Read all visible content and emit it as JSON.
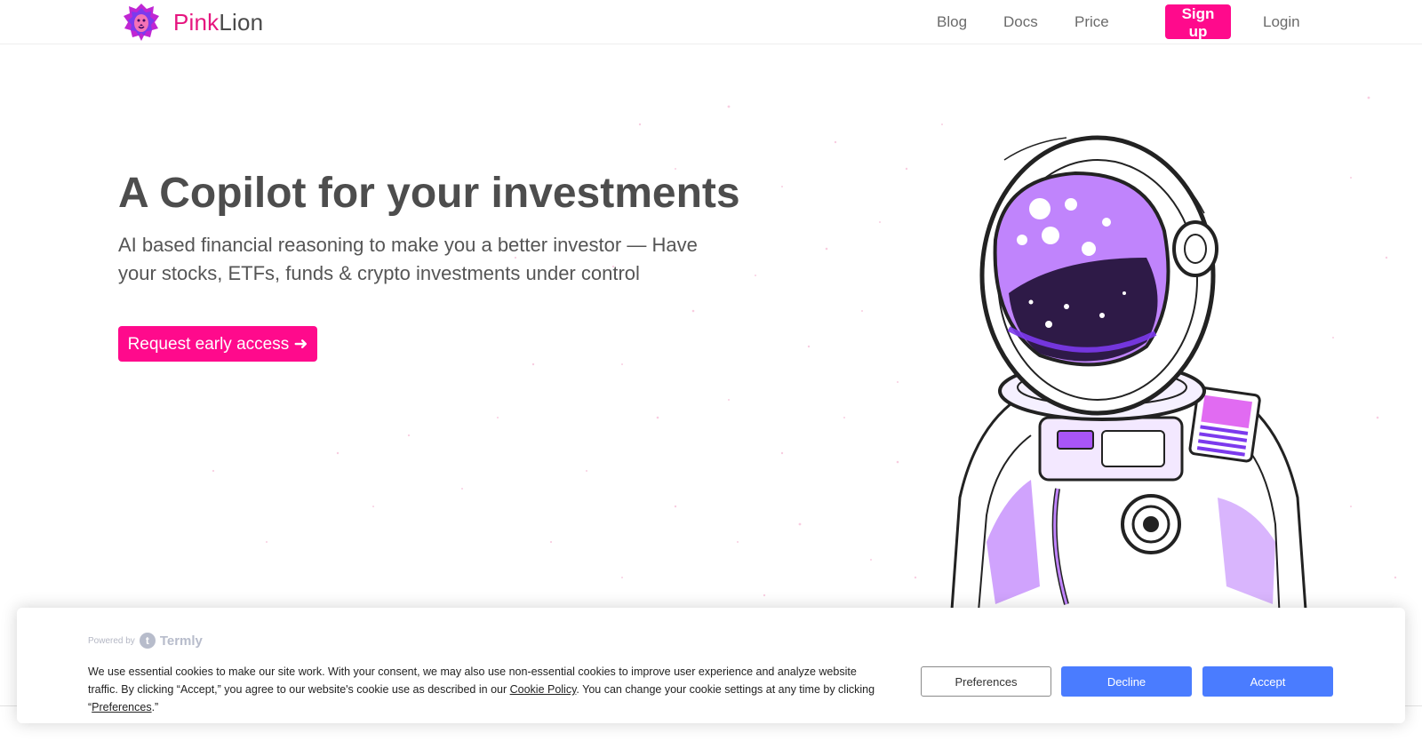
{
  "brand": {
    "name_part1": "Pink",
    "name_part2": "Lion",
    "accent_color": "#e6157f"
  },
  "nav": {
    "blog": "Blog",
    "docs": "Docs",
    "price": "Price",
    "signup": "Sign up",
    "login": "Login"
  },
  "hero": {
    "title": "A Copilot for your investments",
    "subtitle": "AI based financial reasoning to make you a better investor — Have your stocks, ETFs, funds & crypto investments under control",
    "cta": "Request early access ➜",
    "illustration": "astronaut-illustration"
  },
  "cookie": {
    "powered_by": "Powered by",
    "provider": "Termly",
    "text_part1": "We use essential cookies to make our site work. With your consent, we may also use non-essential cookies to improve user experience and analyze website traffic. By clicking “Accept,” you agree to our website's cookie use as described in our ",
    "cookie_policy_link": "Cookie Policy",
    "text_part2": ". You can change your cookie settings at any time by clicking “",
    "preferences_link": "Preferences",
    "text_part3": ".”",
    "preferences_button": "Preferences",
    "decline_button": "Decline",
    "accept_button": "Accept",
    "button_color": "#4a7cff"
  }
}
